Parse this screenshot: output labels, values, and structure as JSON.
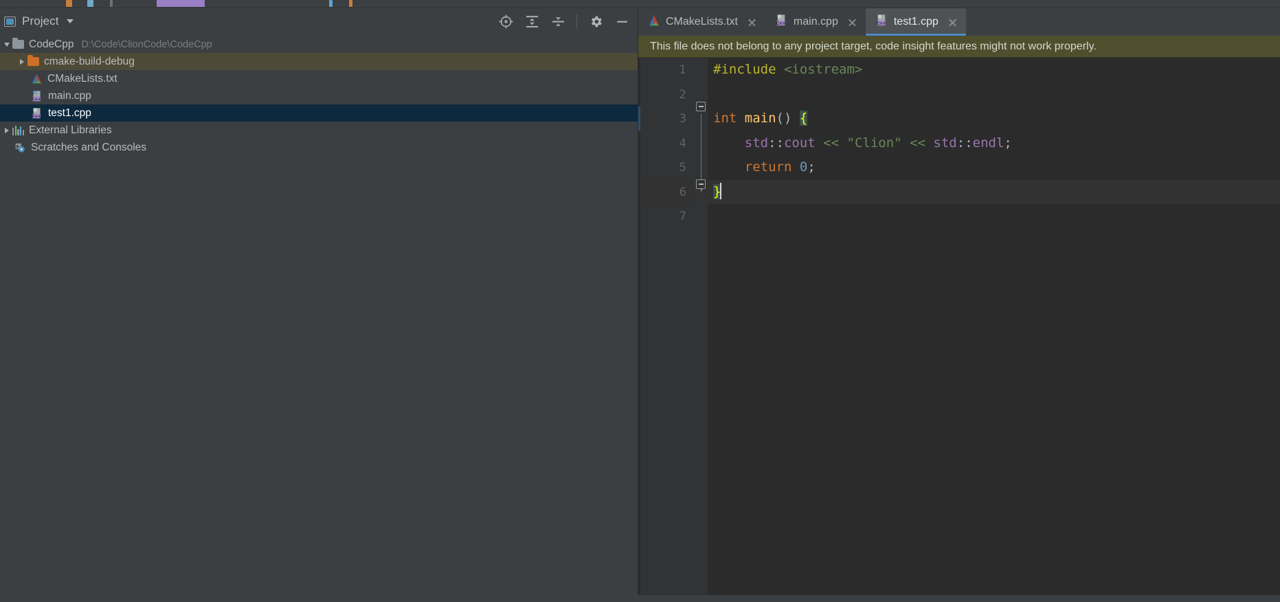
{
  "window": {
    "app": "CLion",
    "theme_bg": "#3c3f41",
    "editor_bg": "#2b2b2b",
    "accent": "#4a88c7"
  },
  "project_panel": {
    "title": "Project",
    "title_icon": "project-window-icon",
    "dropdown_icon": "chevron-down-icon",
    "toolbar": [
      {
        "name": "select-opened-file-icon",
        "label": "Select Opened File"
      },
      {
        "name": "expand-all-icon",
        "label": "Expand All"
      },
      {
        "name": "collapse-all-icon",
        "label": "Collapse All"
      },
      {
        "name": "settings-gear-icon",
        "label": "Settings"
      },
      {
        "name": "hide-icon",
        "label": "Hide"
      }
    ],
    "tree": [
      {
        "label": "CodeCpp",
        "path_hint": "D:\\Code\\ClionCode\\CodeCpp",
        "icon": "folder-grey-icon",
        "arrow": "expanded",
        "indent": 0,
        "state": "none"
      },
      {
        "label": "cmake-build-debug",
        "path_hint": "",
        "icon": "folder-orange-icon",
        "arrow": "collapsed",
        "indent": 1,
        "state": "hover"
      },
      {
        "label": "CMakeLists.txt",
        "path_hint": "",
        "icon": "cmake-file-icon",
        "arrow": "none",
        "indent": 2,
        "state": "none"
      },
      {
        "label": "main.cpp",
        "path_hint": "",
        "icon": "cpp-file-icon",
        "arrow": "none",
        "indent": 2,
        "state": "none"
      },
      {
        "label": "test1.cpp",
        "path_hint": "",
        "icon": "cpp-file-icon",
        "arrow": "none",
        "indent": 2,
        "state": "selected"
      },
      {
        "label": "External Libraries",
        "path_hint": "",
        "icon": "external-libraries-icon",
        "arrow": "collapsed",
        "indent": 0,
        "state": "none"
      },
      {
        "label": "Scratches and Consoles",
        "path_hint": "",
        "icon": "scratches-icon",
        "arrow": "none",
        "indent": 0,
        "state": "none"
      }
    ]
  },
  "editor": {
    "tabs": [
      {
        "label": "CMakeLists.txt",
        "icon": "cmake-file-icon",
        "active": false
      },
      {
        "label": "main.cpp",
        "icon": "cpp-file-icon",
        "active": false
      },
      {
        "label": "test1.cpp",
        "icon": "cpp-file-icon",
        "active": true
      }
    ],
    "close_icon": "close-icon",
    "notification": "This file does not belong to any project target, code insight features might not work properly.",
    "line_numbers": [
      "1",
      "2",
      "3",
      "4",
      "5",
      "6",
      "7"
    ],
    "current_line": 6,
    "changed_line": 3,
    "code_lines": [
      {
        "n": 1,
        "tokens": [
          {
            "t": "#include",
            "c": "s-pre"
          },
          {
            "t": " ",
            "c": "s-punct"
          },
          {
            "t": "<iostream>",
            "c": "s-inc"
          }
        ]
      },
      {
        "n": 2,
        "tokens": []
      },
      {
        "n": 3,
        "tokens": [
          {
            "t": "int",
            "c": "s-key"
          },
          {
            "t": " ",
            "c": "s-punct"
          },
          {
            "t": "main",
            "c": "s-fn"
          },
          {
            "t": "()",
            "c": "s-punct"
          },
          {
            "t": " ",
            "c": "s-punct"
          },
          {
            "t": "{",
            "c": "s-brace-hl"
          }
        ]
      },
      {
        "n": 4,
        "tokens": [
          {
            "t": "    ",
            "c": "s-punct"
          },
          {
            "t": "std",
            "c": "s-ns"
          },
          {
            "t": "::",
            "c": "s-op"
          },
          {
            "t": "cout",
            "c": "s-ns"
          },
          {
            "t": " ",
            "c": "s-punct"
          },
          {
            "t": "<<",
            "c": "s-str"
          },
          {
            "t": " ",
            "c": "s-punct"
          },
          {
            "t": "\"Clion\"",
            "c": "s-str"
          },
          {
            "t": " ",
            "c": "s-punct"
          },
          {
            "t": "<<",
            "c": "s-str"
          },
          {
            "t": " ",
            "c": "s-punct"
          },
          {
            "t": "std",
            "c": "s-ns"
          },
          {
            "t": "::",
            "c": "s-op"
          },
          {
            "t": "endl",
            "c": "s-ns"
          },
          {
            "t": ";",
            "c": "s-punct"
          }
        ]
      },
      {
        "n": 5,
        "tokens": [
          {
            "t": "    ",
            "c": "s-punct"
          },
          {
            "t": "return",
            "c": "s-key"
          },
          {
            "t": " ",
            "c": "s-punct"
          },
          {
            "t": "0",
            "c": "s-num"
          },
          {
            "t": ";",
            "c": "s-punct"
          }
        ]
      },
      {
        "n": 6,
        "tokens": [
          {
            "t": "}",
            "c": "s-brace-hl"
          }
        ]
      },
      {
        "n": 7,
        "tokens": []
      }
    ]
  }
}
